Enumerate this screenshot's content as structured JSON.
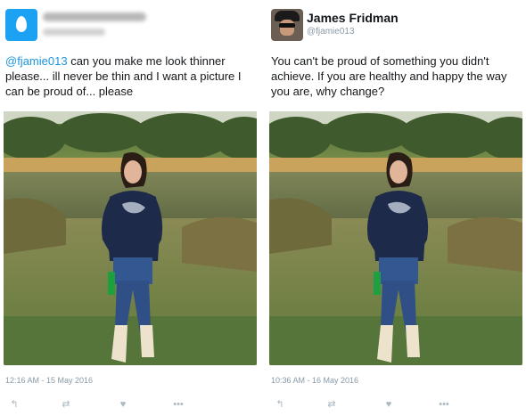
{
  "left_tweet": {
    "mention": "@fjamie013",
    "text": " can you make me look thinner please... ill never be thin and I want a picture I can be proud of... please",
    "timestamp": "12:16 AM - 15 May 2016",
    "avatar_icon": "egg-avatar-icon"
  },
  "right_tweet": {
    "name": "James Fridman",
    "handle": "@fjamie013",
    "text": "You can't be proud of something you didn't achieve. If you are healthy and happy the way you are, why change?",
    "timestamp": "10:36 AM - 16 May 2016"
  },
  "actions": {
    "reply_glyph": "↰",
    "retweet_glyph": "⇄",
    "like_glyph": "♥",
    "more_glyph": "•••"
  },
  "colors": {
    "link": "#1b95e0",
    "muted": "#8899a6",
    "egg_bg": "#1da1f2"
  }
}
